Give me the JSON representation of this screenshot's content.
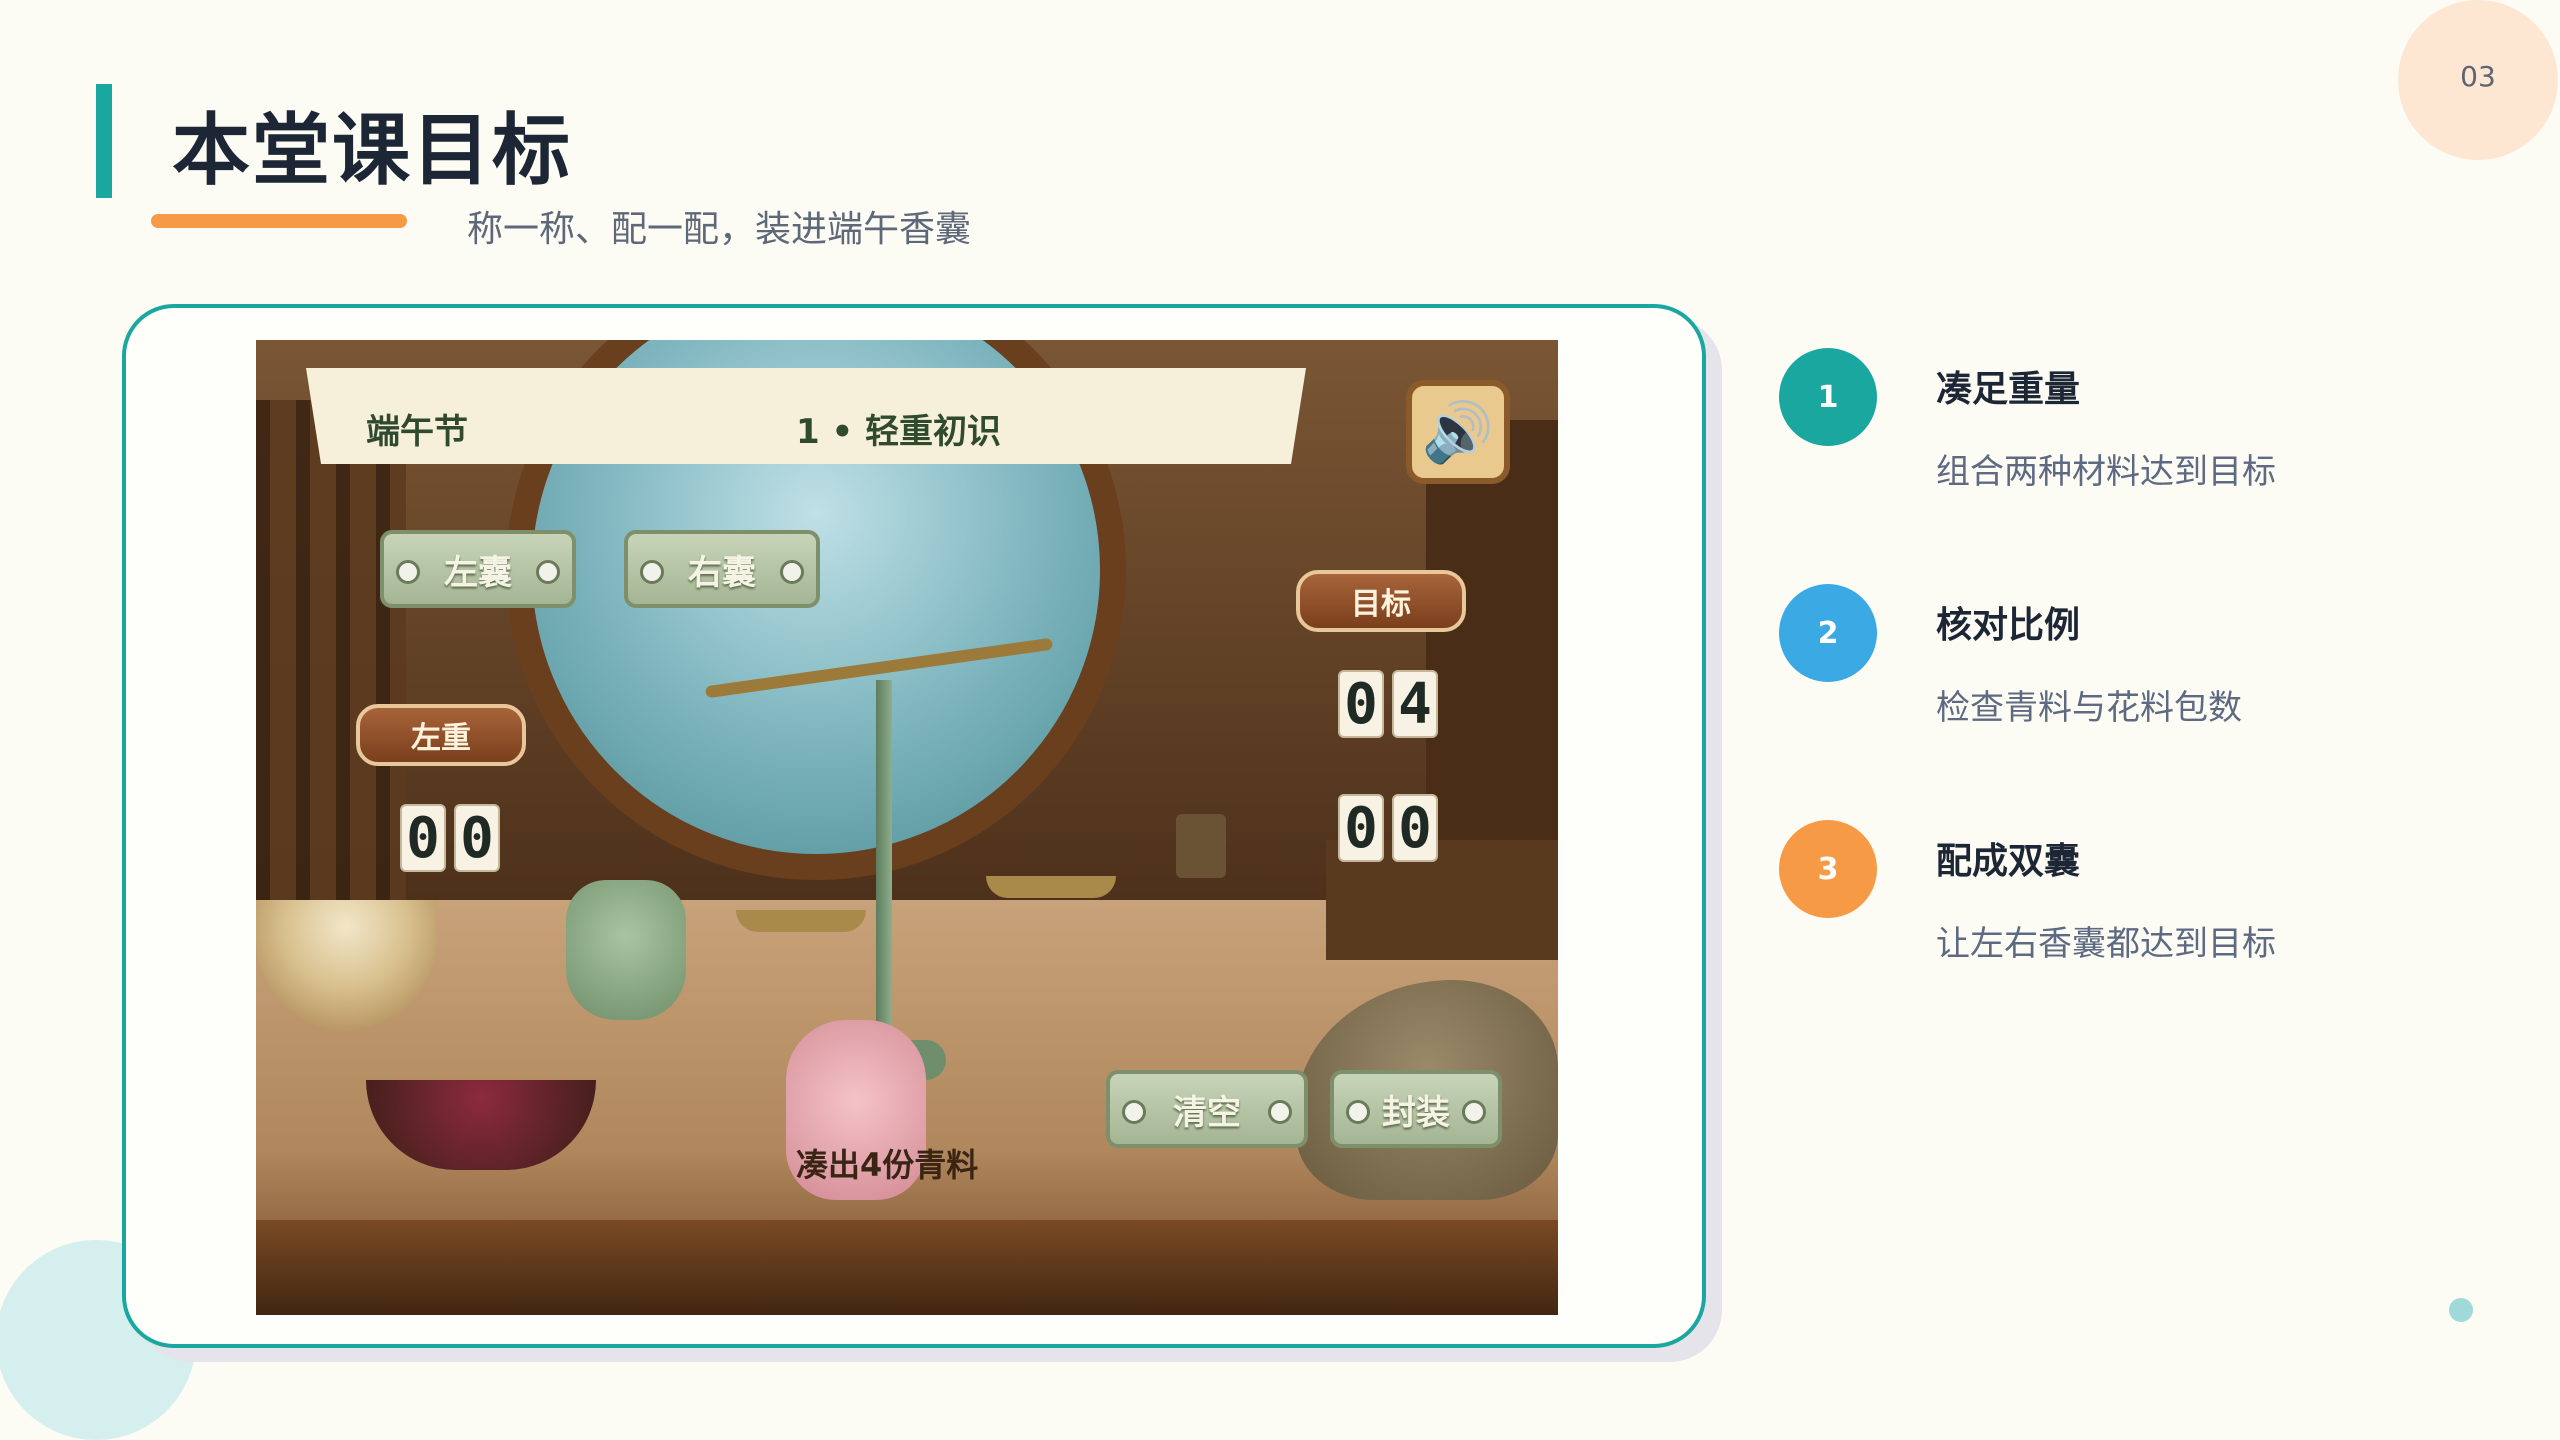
{
  "page_number": "03",
  "header": {
    "title": "本堂课目标",
    "subtitle": "称一称、配一配，装进端午香囊"
  },
  "colors": {
    "accent_teal": "#1aa7a0",
    "accent_orange": "#f79a45",
    "accent_blue": "#3ba9e4",
    "background": "#fcfbf4"
  },
  "game": {
    "festival": "端午节",
    "level": "1 • 轻重初识",
    "sound_icon": "speaker-icon",
    "buttons": {
      "left_bag": "左囊",
      "right_bag": "右囊",
      "clear": "清空",
      "seal": "封装"
    },
    "labels": {
      "left_weight": "左重",
      "target": "目标"
    },
    "left_weight_digits": [
      "0",
      "0"
    ],
    "target_top_digits": [
      "0",
      "4"
    ],
    "target_bottom_digits": [
      "0",
      "0"
    ],
    "caption": "凑出4份青料"
  },
  "goals": [
    {
      "number": "1",
      "title": "凑足重量",
      "desc": "组合两种材料达到目标"
    },
    {
      "number": "2",
      "title": "核对比例",
      "desc": "检查青料与花料包数"
    },
    {
      "number": "3",
      "title": "配成双囊",
      "desc": "让左右香囊都达到目标"
    }
  ]
}
